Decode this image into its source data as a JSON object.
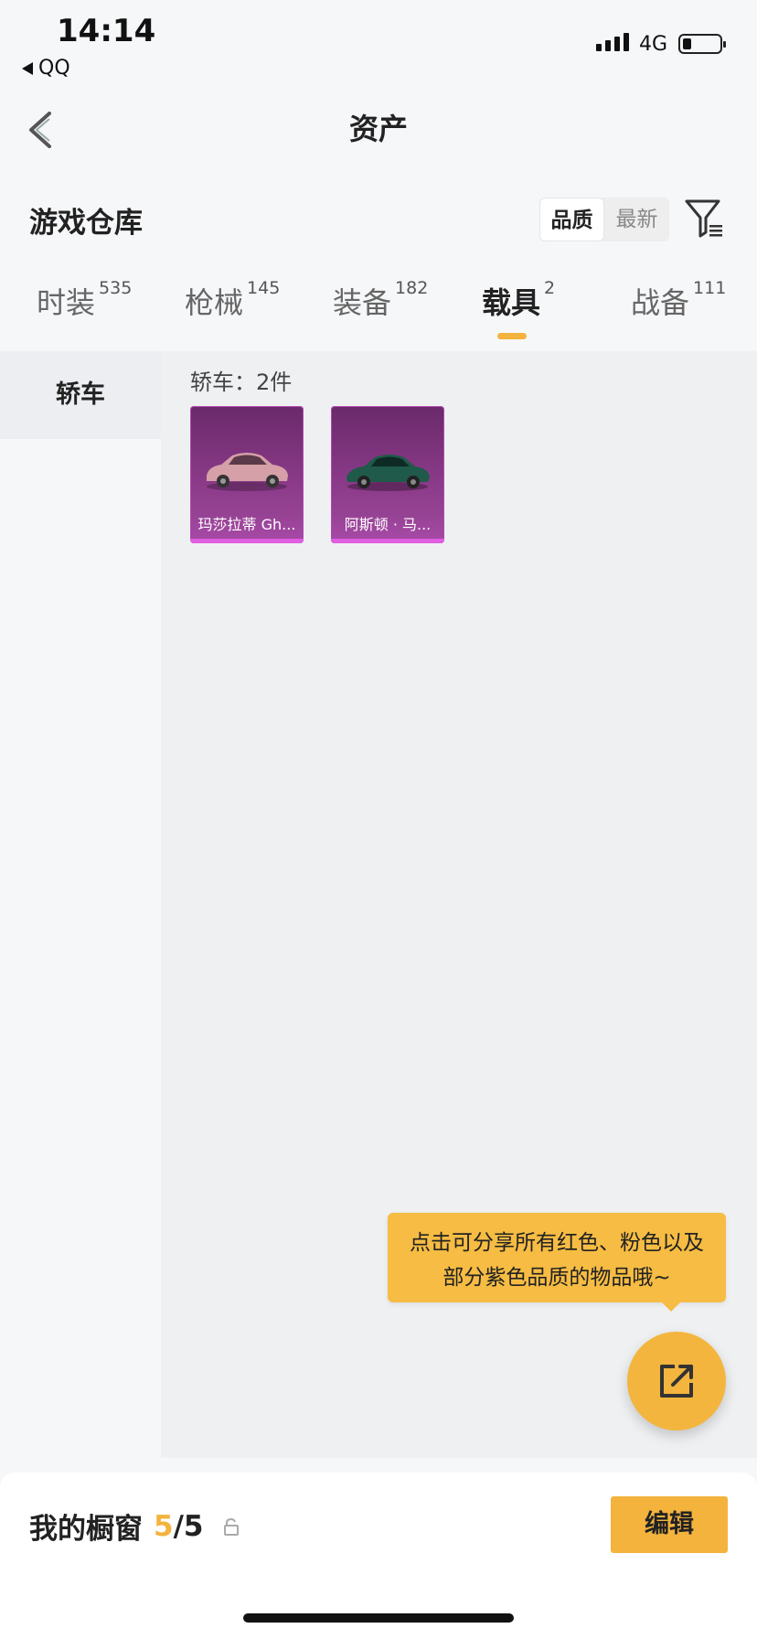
{
  "status_bar": {
    "time": "14:14",
    "back_app": "QQ",
    "network": "4G"
  },
  "nav": {
    "title": "资产"
  },
  "header": {
    "title": "游戏仓库",
    "sort_options": [
      "品质",
      "最新"
    ],
    "active_sort": "品质"
  },
  "tabs": [
    {
      "label": "时装",
      "count": "535"
    },
    {
      "label": "枪械",
      "count": "145"
    },
    {
      "label": "装备",
      "count": "182"
    },
    {
      "label": "载具",
      "count": "2",
      "active": true
    },
    {
      "label": "战备",
      "count": "111"
    }
  ],
  "sidebar": {
    "items": [
      "轿车"
    ]
  },
  "content": {
    "count_label": "轿车：2件",
    "items": [
      {
        "name": "玛莎拉蒂 Gh...",
        "color": "#d6a0a8"
      },
      {
        "name": "阿斯顿 · 马...",
        "color": "#1f5a4a"
      }
    ]
  },
  "tooltip": {
    "line1": "点击可分享所有红色、粉色以及",
    "line2": "部分紫色品质的物品哦~"
  },
  "bottom": {
    "label": "我的橱窗",
    "used": "5",
    "total": "/5",
    "edit": "编辑"
  },
  "colors": {
    "accent": "#f3b33d",
    "card_purple": "#8a3a88"
  }
}
